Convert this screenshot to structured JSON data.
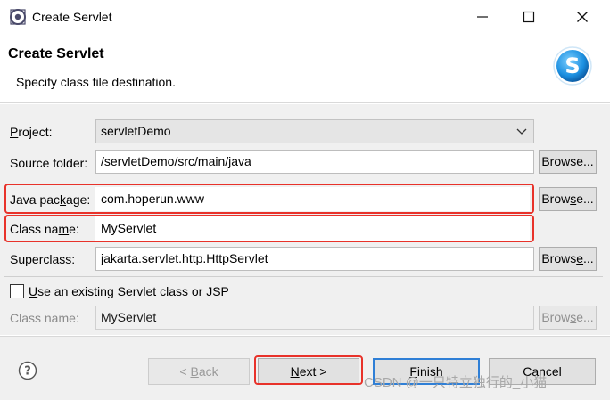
{
  "window": {
    "title": "Create Servlet",
    "controls": [
      "minimize-icon",
      "maximize-icon",
      "close-icon"
    ]
  },
  "header": {
    "title": "Create Servlet",
    "description": "Specify class file destination.",
    "logo_letter": "S"
  },
  "form": {
    "project": {
      "label_mn": "P",
      "label_rest": "roject:",
      "value": "servletDemo"
    },
    "source_folder": {
      "label": "Source folder:",
      "value": "/servletDemo/src/main/java",
      "browse_mn": "Brow",
      "browse_u": "s",
      "browse_rest": "e..."
    },
    "java_package": {
      "label_a": "Java pac",
      "label_mn": "k",
      "label_b": "age:",
      "value": "com.hoperun.www",
      "browse_mn": "Brow",
      "browse_u": "s",
      "browse_rest": "e..."
    },
    "class_name": {
      "label_a": "Class na",
      "label_mn": "m",
      "label_b": "e:",
      "value": "MyServlet"
    },
    "superclass": {
      "label_mn": "S",
      "label_rest": "uperclass:",
      "value": "jakarta.servlet.http.HttpServlet",
      "browse_a": "Brows",
      "browse_u": "e",
      "browse_rest": "..."
    },
    "use_existing": {
      "label_mn": "U",
      "label_rest": "se an existing Servlet class or JSP",
      "checked": false
    },
    "existing_class_name": {
      "label": "Class name:",
      "value": "MyServlet",
      "browse_a": "Brow",
      "browse_u": "s",
      "browse_rest": "e..."
    }
  },
  "footer": {
    "back": {
      "prefix": "< ",
      "mn": "B",
      "rest": "ack"
    },
    "next": {
      "mn": "N",
      "rest": "ext >"
    },
    "finish": {
      "mn": "F",
      "rest": "inish"
    },
    "cancel": "Cancel",
    "watermark": "CSDN @一只特立独行的_小猫"
  },
  "colors": {
    "highlight": "#e8322a",
    "default_button_border": "#2f7fd6",
    "logo_blue": "#1b8fe0"
  }
}
